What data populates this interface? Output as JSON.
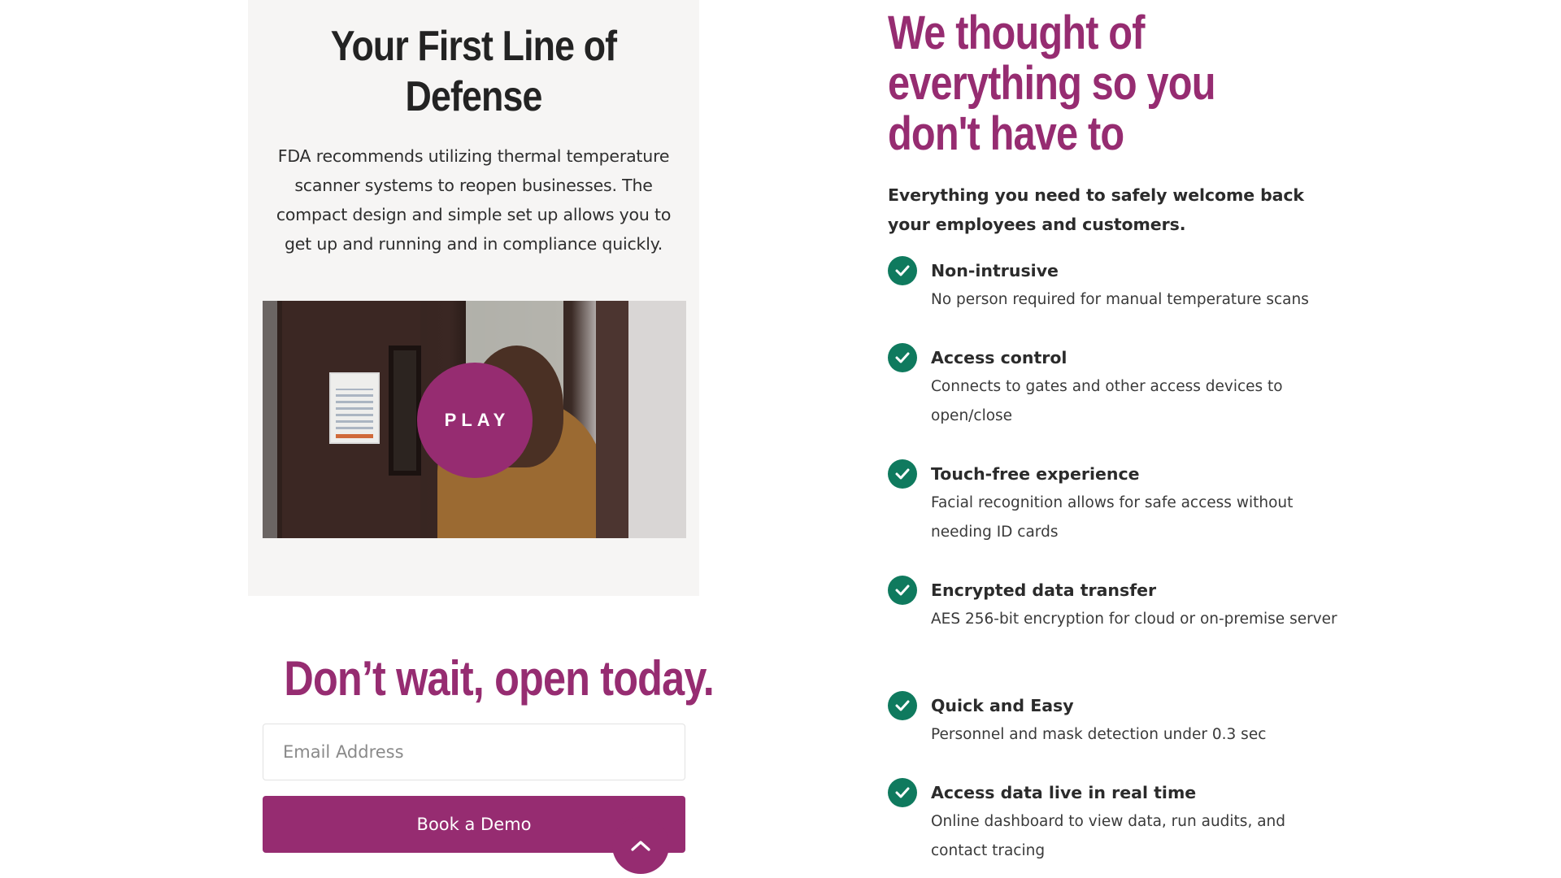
{
  "hero_card": {
    "title": "Your First Line of Defense",
    "description": "FDA recommends utilizing thermal temperature scanner systems to reopen businesses. The compact design and simple set up allows you to get up and running and in compliance quickly.",
    "video": {
      "play_label": "PLAY"
    }
  },
  "cta": {
    "heading": "Don’t wait, open today.",
    "email_placeholder": "Email Address",
    "button_label": "Book a Demo"
  },
  "features_section": {
    "heading": "We thought of everything so you don't have to",
    "subheading": "Everything you need to safely welcome back your employees and customers.",
    "items": [
      {
        "title": "Non-intrusive",
        "description": "No person required for manual temperature scans"
      },
      {
        "title": "Access control",
        "description": "Connects to gates and other access devices to open/close"
      },
      {
        "title": "Touch-free experience",
        "description": "Facial recognition allows for safe access without needing ID cards"
      },
      {
        "title": "Encrypted data transfer",
        "description": "AES 256-bit encryption for cloud or on-premise server"
      },
      {
        "title": "Quick and Easy",
        "description": "Personnel and mask detection under 0.3 sec"
      },
      {
        "title": "Access data live in real time",
        "description": "Online dashboard to view data, run audits, and contact tracing"
      }
    ]
  },
  "colors": {
    "brand_magenta": "#962c71",
    "check_green": "#0f7a5e",
    "card_background": "#f6f5f4"
  },
  "icons": {
    "feature_check": "check-circle-icon",
    "scroll_top": "chevron-up-icon"
  }
}
